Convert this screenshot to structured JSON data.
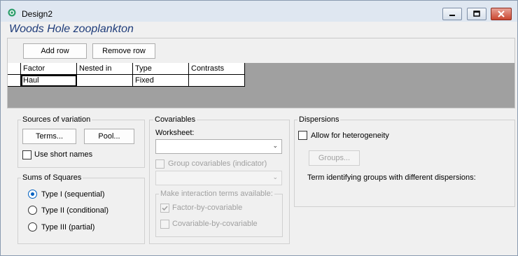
{
  "window": {
    "title": "Design2",
    "subtitle": "Woods Hole zooplankton"
  },
  "toolbar": {
    "add_row": "Add row",
    "remove_row": "Remove row"
  },
  "table": {
    "headers": [
      "Factor",
      "Nested in",
      "Type",
      "Contrasts"
    ],
    "rows": [
      [
        "Haul",
        "",
        "Fixed",
        ""
      ]
    ]
  },
  "sources": {
    "title": "Sources of variation",
    "terms": "Terms...",
    "pool": "Pool...",
    "short_names": "Use short names",
    "short_names_checked": false
  },
  "sums": {
    "title": "Sums of Squares",
    "options": [
      "Type I (sequential)",
      "Type II (conditional)",
      "Type III (partial)"
    ],
    "selected": 0
  },
  "covariables": {
    "title": "Covariables",
    "worksheet_label": "Worksheet:",
    "worksheet_value": "",
    "group_label": "Group covariables (indicator)",
    "group_value": "",
    "interactions_title": "Make interaction terms available:",
    "factor_by_cov": "Factor-by-covariable",
    "factor_by_cov_checked": true,
    "cov_by_cov": "Covariable-by-covariable",
    "cov_by_cov_checked": false
  },
  "dispersions": {
    "title": "Dispersions",
    "allow_label": "Allow for heterogeneity",
    "allow_checked": false,
    "groups_button": "Groups...",
    "term_label": "Term identifying groups with different dispersions:"
  },
  "colors": {
    "accent": "#0060c0",
    "subtitle": "#1f3c7a",
    "grid_bg": "#a0a0a0"
  }
}
